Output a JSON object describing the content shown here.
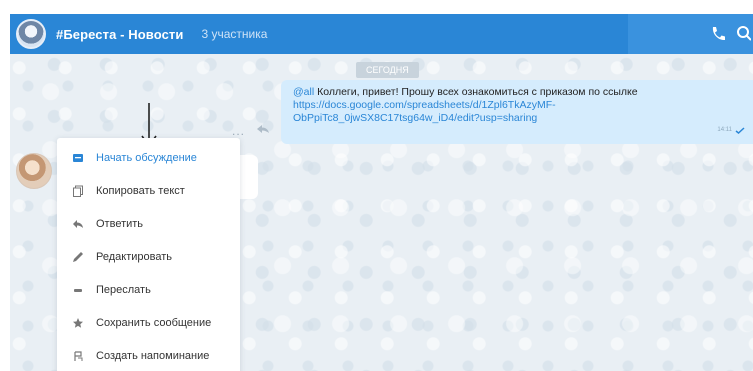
{
  "header": {
    "chat_title": "#Береста - Новости",
    "members": "3 участника",
    "accent_color": "#2a86d6",
    "icons": [
      "avatar",
      "phone-icon",
      "search-icon"
    ]
  },
  "chat": {
    "date_label": "СЕГОДНЯ",
    "message": {
      "mention": "@all",
      "text": " Коллеги, привет! Прошу всех ознакомиться с приказом по ссылке",
      "link_line1": "https://docs.google.com/spreadsheets/d/1Zpl6TkAzyMF-",
      "link_line2": "ObPpiTc8_0jwSX8C17tsg64w_iD4/edit?usp=sharing",
      "time": "14:11",
      "bubble_color": "#d5ecfd"
    },
    "message_actions": "..."
  },
  "context_menu": {
    "items": [
      {
        "label": "Начать обсуждение",
        "icon": "discussion-icon",
        "active": true
      },
      {
        "label": "Копировать текст",
        "icon": "copy-icon"
      },
      {
        "label": "Ответить",
        "icon": "reply-icon"
      },
      {
        "label": "Редактировать",
        "icon": "edit-icon"
      },
      {
        "label": "Переслать",
        "icon": "forward-icon"
      },
      {
        "label": "Сохранить сообщение",
        "icon": "star-icon"
      },
      {
        "label": "Создать напоминание",
        "icon": "reminder-icon"
      }
    ]
  }
}
